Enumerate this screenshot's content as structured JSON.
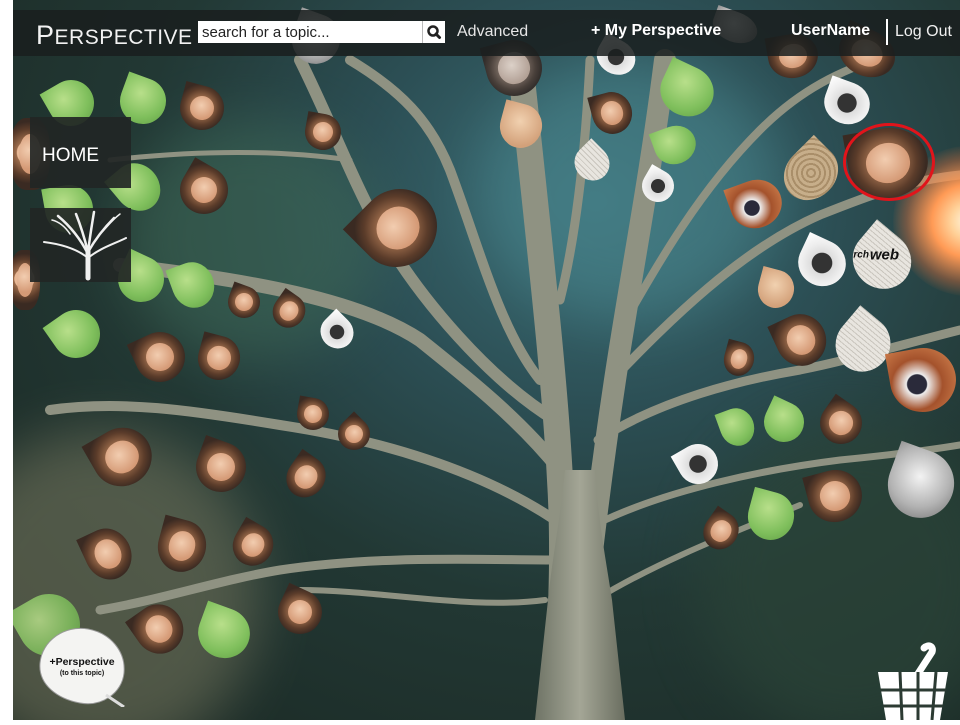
{
  "app": {
    "logo": "Perspective",
    "logo_initial": "P",
    "logo_rest": "ERSPECTIVE"
  },
  "topbar": {
    "search_placeholder": "search for a topic...",
    "search_icon": "magnifier-icon",
    "advanced": "Advanced",
    "my_perspective": "+ My Perspective",
    "username": "UserName",
    "logout": "Log Out"
  },
  "sidebar": {
    "home": "HOME",
    "tree_icon": "tree-icon"
  },
  "add_perspective": {
    "title": "+Perspective",
    "subtitle": "(to this topic)"
  },
  "basket": {
    "icon": "basket-icon"
  },
  "leaves": {
    "web_label": "web",
    "web_label2": "rch"
  },
  "colors": {
    "topbar_bg": "#1a1e1e",
    "highlight_ring": "#e1141b",
    "background": "#2c4f55"
  }
}
